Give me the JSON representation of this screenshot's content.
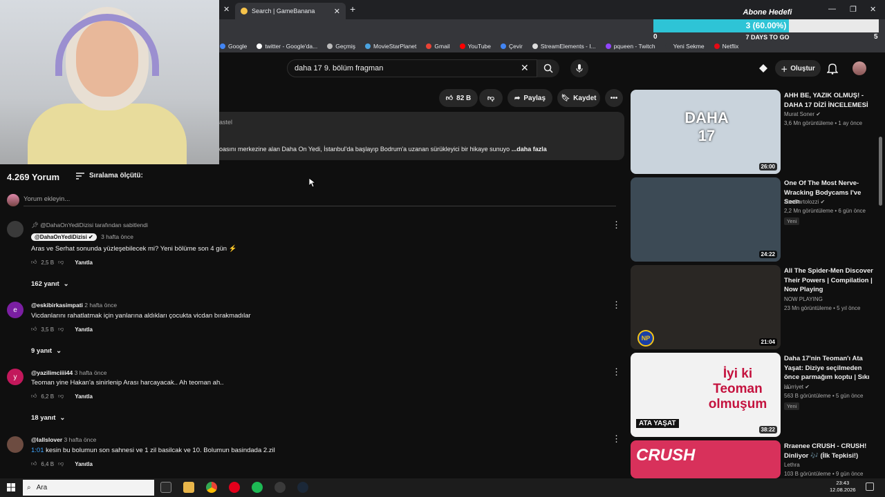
{
  "browser": {
    "tab_title": "Search | GameBanana",
    "bookmarks": [
      {
        "label": "Google",
        "color": "#4285f4"
      },
      {
        "label": "twitter - Google'da...",
        "color": "#ffffff"
      },
      {
        "label": "Geçmiş",
        "color": "#bbbbbb"
      },
      {
        "label": "MovieStarPlanet",
        "color": "#4aa3e0"
      },
      {
        "label": "Gmail",
        "color": "#ea4335"
      },
      {
        "label": "YouTube",
        "color": "#ff0000"
      },
      {
        "label": "Çevir",
        "color": "#4285f4"
      },
      {
        "label": "StreamElements - I...",
        "color": "#dddddd"
      },
      {
        "label": "pqueen - Twitch",
        "color": "#9146ff"
      },
      {
        "label": "Yeni Sekme",
        "color": "#35363a"
      },
      {
        "label": "Netflix",
        "color": "#e50914"
      }
    ]
  },
  "goal": {
    "title": "Abone Hedefi",
    "value_text": "3 (60.00%)",
    "fraction": 0.6,
    "min": "0",
    "max": "5",
    "days": "7 DAYS TO GO"
  },
  "header": {
    "search_query": "daha 17 9. bölüm fragman",
    "create_label": "Oluştur"
  },
  "video": {
    "likes": "82 B",
    "share_label": "Paylaş",
    "save_label": "Kaydet",
    "desc_tag": "astel",
    "desc_text": "oasını merkezine alan Daha On Yedi, İstanbul'da başlayıp Bodrum'a uzanan sürükleyici bir hikaye sunuyo",
    "desc_more": "...daha fazla"
  },
  "comments_header": {
    "count": "4.269 Yorum",
    "sort_label": "Sıralama ölçütü:",
    "add_placeholder": "Yorum ekleyin..."
  },
  "comments": [
    {
      "pinned": "@DahaOnYediDizisi tarafından sabitlendi",
      "author": "@DahaOnYediDizisi",
      "time": "3 hafta önce",
      "text": "Aras ve Serhat sonunda yüzleşebilecek mi? Yeni bölüme son 4 gün ⚡",
      "likes": "2,5 B",
      "reply": "Yanıtla",
      "replies": "162 yanıt",
      "avatar_color": "#3a3a3a",
      "avatar_letter": ""
    },
    {
      "author": "@eskibirkasimpati",
      "time": "2 hafta önce",
      "text": "Vicdanlarını rahatlatmak için yanlarına aldıkları çocukta vicdan bırakmadılar",
      "likes": "3,5 B",
      "reply": "Yanıtla",
      "replies": "9 yanıt",
      "avatar_color": "#7b1fa2",
      "avatar_letter": "e"
    },
    {
      "author": "@yazilimciiii44",
      "time": "3 hafta önce",
      "text": "Teoman yine Hakan'a sinirlenip Arası harcayacak.. Ah teoman ah..",
      "likes": "6,2 B",
      "reply": "Yanıtla",
      "replies": "18 yanıt",
      "avatar_color": "#c2185b",
      "avatar_letter": "y"
    },
    {
      "author": "@lallslover",
      "time": "3 hafta önce",
      "timestamp": "1:01",
      "text": " kesin bu bolumun son sahnesi ve 1 zil basilcak ve 10. Bolumun basindada 2.zil",
      "likes": "6,4 B",
      "reply": "Yanıtla",
      "avatar_color": "#6d4c41",
      "avatar_letter": ""
    }
  ],
  "sidebar": [
    {
      "title": "AHH BE, YAZIK OLMUŞ! - DAHA 17 DİZİ İNCELEMESİ",
      "channel": "Murat Soner",
      "verified": true,
      "stats": "3,6 Mn görüntüleme • 1 ay önce",
      "duration": "26:00",
      "thumb_text": "DAHA 17",
      "thumb_bg": "#c9d3dc"
    },
    {
      "title": "One Of The Most Nerve-Wracking Bodycams I've Seen",
      "channel": "Joe Bartolozzi",
      "verified": true,
      "stats": "2,2 Mn görüntüleme • 6 gün önce",
      "badge": "Yeni",
      "duration": "24:22",
      "thumb_text": "",
      "thumb_bg": "#3c4a55"
    },
    {
      "title": "All The Spider-Men Discover Their Powers | Compilation | Now Playing",
      "channel": "NOW PLAYING",
      "verified": false,
      "stats": "23 Mn görüntüleme • 5 yıl önce",
      "duration": "21:04",
      "thumb_text": "NP",
      "thumb_bg": "#2a2724"
    },
    {
      "title": "Daha 17'nin Teoman'ı Ata Yaşat: Diziye seçilmeden önce parmağım koptu | Sıkı ...",
      "channel": "Hürriyet",
      "verified": true,
      "stats": "563 B görüntüleme • 5 gün önce",
      "badge": "Yeni",
      "duration": "38:22",
      "thumb_text": "İyi ki Teoman olmuşum",
      "thumb_caption": "ATA YAŞAT",
      "thumb_bg": "#f2f2f2"
    },
    {
      "title": "Rraenee CRUSH - CRUSH! Dinliyor 🎶 (İlk Tepkisi!)",
      "channel": "Lethra",
      "verified": false,
      "stats": "103 B görüntüleme • 9 gün önce",
      "duration": "",
      "thumb_text": "CRUSH",
      "thumb_bg": "#d8315b"
    }
  ],
  "taskbar": {
    "search_label": "Ara",
    "time": "23:43",
    "date": "12.08.2026"
  }
}
